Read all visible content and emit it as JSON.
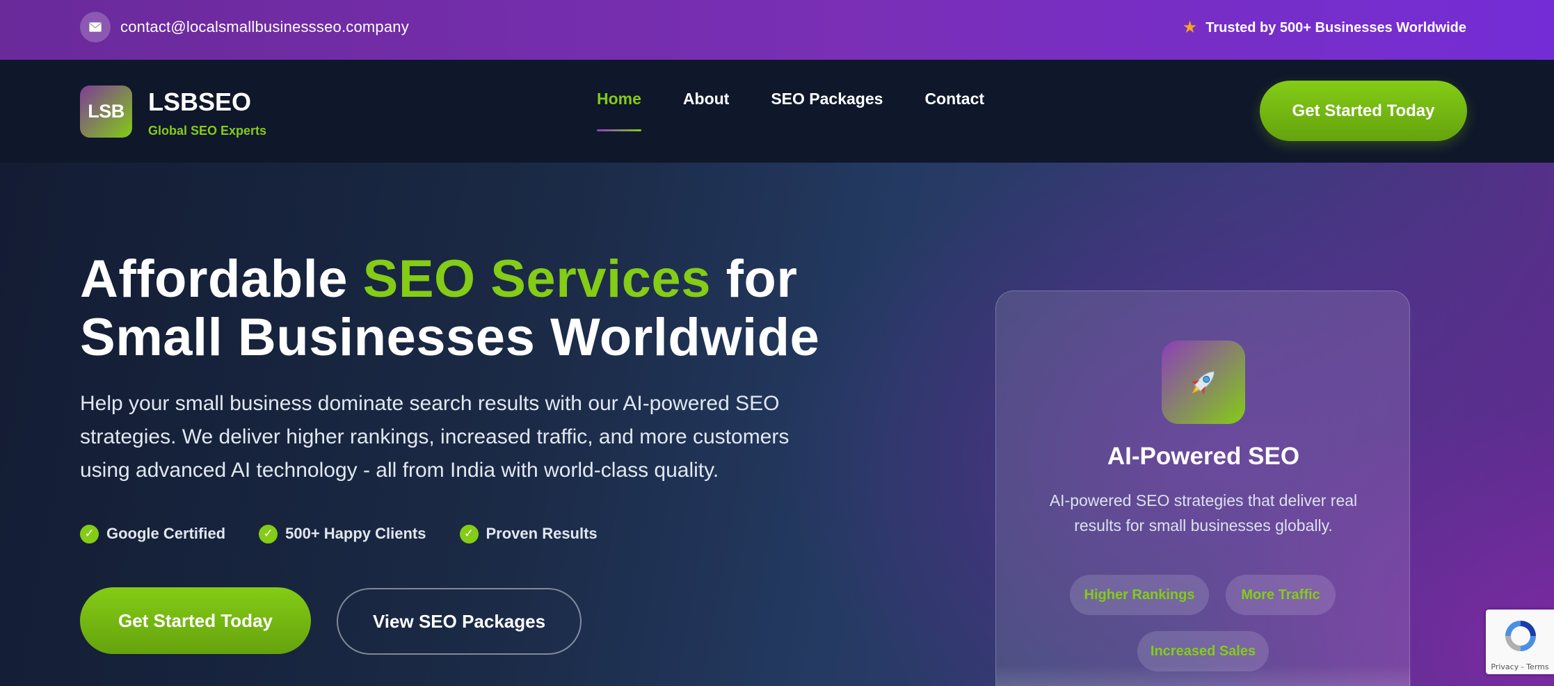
{
  "topbar": {
    "email": "contact@localsmallbusinessseo.company",
    "email_icon": "mail-icon",
    "trust_icon": "star-icon",
    "trust_text": "Trusted by 500+ Businesses Worldwide"
  },
  "brand": {
    "logo_text": "LSB",
    "name": "LSBSEO",
    "tagline": "Global SEO Experts"
  },
  "nav": {
    "items": [
      {
        "label": "Home",
        "active": true
      },
      {
        "label": "About",
        "active": false
      },
      {
        "label": "SEO Packages",
        "active": false
      },
      {
        "label": "Contact",
        "active": false
      }
    ],
    "cta_label": "Get Started Today"
  },
  "hero": {
    "title_part1": "Affordable ",
    "title_accent": "SEO Services",
    "title_part2": " for Small Businesses Worldwide",
    "description": "Help your small business dominate search results with our AI-powered SEO strategies. We deliver higher rankings, increased traffic, and more customers using advanced AI technology - all from India with world-class quality.",
    "badges": [
      {
        "icon": "check-icon",
        "label": "Google Certified"
      },
      {
        "icon": "check-icon",
        "label": "500+ Happy Clients"
      },
      {
        "icon": "check-icon",
        "label": "Proven Results"
      }
    ],
    "primary_button": "Get Started Today",
    "secondary_button": "View SEO Packages"
  },
  "card": {
    "icon": "rocket-icon",
    "title": "AI-Powered SEO",
    "description": "AI-powered SEO strategies that deliver real results for small businesses globally.",
    "tags": [
      "Higher Rankings",
      "More Traffic",
      "Increased Sales"
    ]
  },
  "recaptcha": {
    "links": "Privacy - Terms"
  },
  "colors": {
    "accent_green": "#84cc16",
    "brand_purple": "#7a2fb6",
    "nav_background": "#0f172a"
  }
}
